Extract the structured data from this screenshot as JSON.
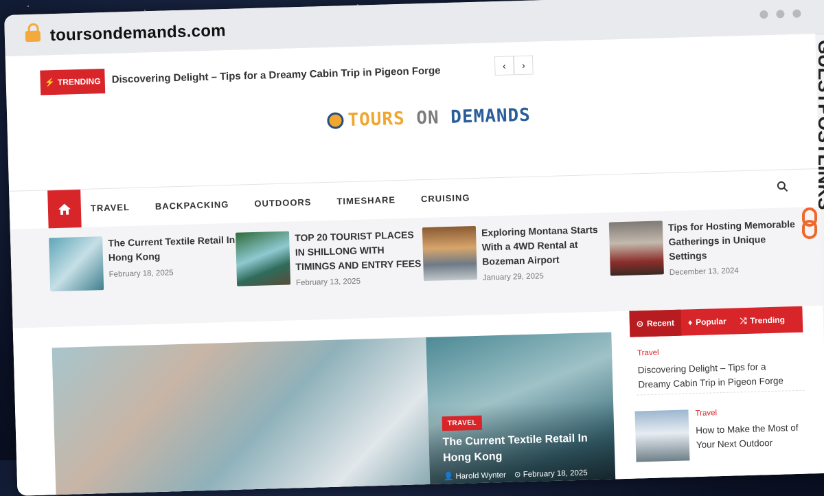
{
  "browser": {
    "url": "toursondemands.com"
  },
  "trending": {
    "label": "TRENDING",
    "headline": "Discovering Delight – Tips for a Dreamy Cabin Trip in Pigeon Forge"
  },
  "logo": {
    "part1": "TOURS",
    "part2": "ON",
    "part3": "DEMANDS"
  },
  "nav": {
    "items": [
      "TRAVEL",
      "BACKPACKING",
      "OUTDOORS",
      "TIMESHARE",
      "CRUISING"
    ]
  },
  "featured": [
    {
      "title": "The Current Textile Retail In Hong Kong",
      "date": "February 18, 2025"
    },
    {
      "title": "TOP 20 TOURIST PLACES IN SHILLONG WITH TIMINGS AND ENTRY FEES",
      "date": "February 13, 2025"
    },
    {
      "title": "Exploring Montana Starts With a 4WD Rental at Bozeman Airport",
      "date": "January 29, 2025"
    },
    {
      "title": "Tips for Hosting Memorable Gatherings in Unique Settings",
      "date": "December 13, 2024"
    }
  ],
  "hero": {
    "category": "TRAVEL",
    "title": "The Current Textile Retail In Hong Kong",
    "author": "Harold Wynter",
    "date": "February 18, 2025"
  },
  "sidebar": {
    "tabs": [
      "Recent",
      "Popular",
      "Trending"
    ],
    "posts": [
      {
        "category": "Travel",
        "title": "Discovering Delight – Tips for a Dreamy Cabin Trip in Pigeon Forge"
      },
      {
        "category": "Travel",
        "title": "How to Make the Most of Your Next Outdoor"
      }
    ]
  },
  "watermark": "GUESTPOSTLINKS",
  "colors": {
    "accent": "#d7252a",
    "logo_orange": "#f1a630",
    "logo_blue": "#2a5d9a"
  }
}
